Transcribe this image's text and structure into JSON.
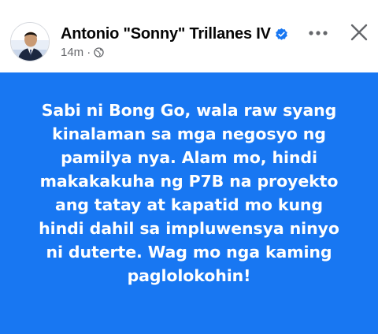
{
  "post": {
    "author": "Antonio \"Sonny\" Trillanes IV",
    "timestamp": "14m",
    "separator": "·",
    "audience_icon": "globe-icon",
    "verified_icon": "verified-badge-icon",
    "more_icon": "more-options-icon",
    "close_icon": "close-icon",
    "text_lines": [
      "Sabi ni Bong Go, wala raw syang",
      "kinalaman sa mga negosyo ng",
      "pamilya nya. Alam mo, hindi",
      "makakakuha ng P7B na proyekto",
      "ang tatay at kapatid mo kung",
      "hindi dahil sa impluwensya ninyo",
      "ni duterte. Wag mo nga kaming",
      "paglolokohin!"
    ]
  },
  "colors": {
    "card_background": "#1877f2",
    "card_text": "#ffffff",
    "author_text": "#050505",
    "meta_text": "#65676b",
    "verified": "#1877f2"
  }
}
